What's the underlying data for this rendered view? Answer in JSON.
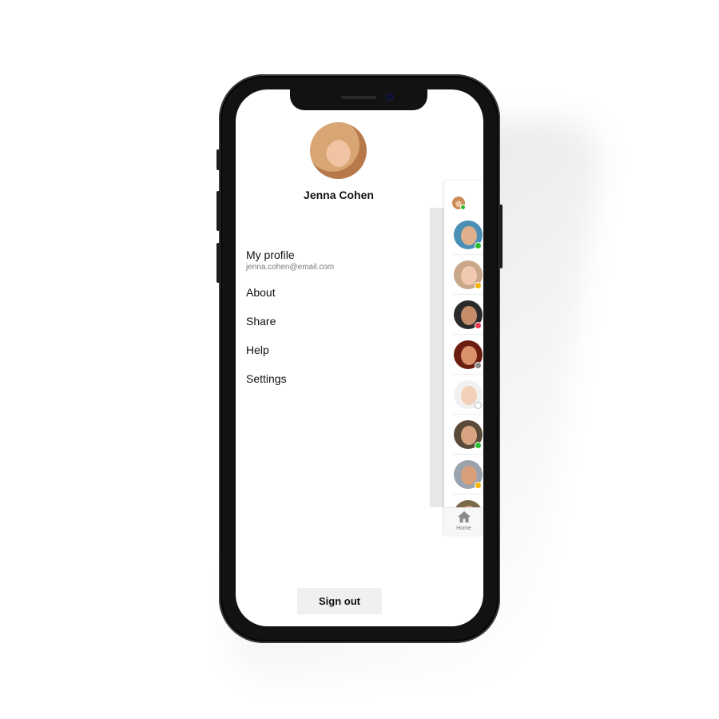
{
  "user": {
    "name": "Jenna Cohen",
    "status_color": "#2dbb2d"
  },
  "menu": {
    "profile_label": "My profile",
    "profile_email": "jenna.cohen@email.com",
    "items": [
      "About",
      "Share",
      "Help",
      "Settings"
    ]
  },
  "signout_label": "Sign out",
  "contacts": {
    "status_colors": [
      "#2dbb2d",
      "#f6b400",
      "#e8384f",
      "#888888",
      "#cccccc",
      "#2dbb2d",
      "#f6b400"
    ]
  },
  "tabbar": {
    "home_label": "Home",
    "home_icon": "home-icon"
  }
}
